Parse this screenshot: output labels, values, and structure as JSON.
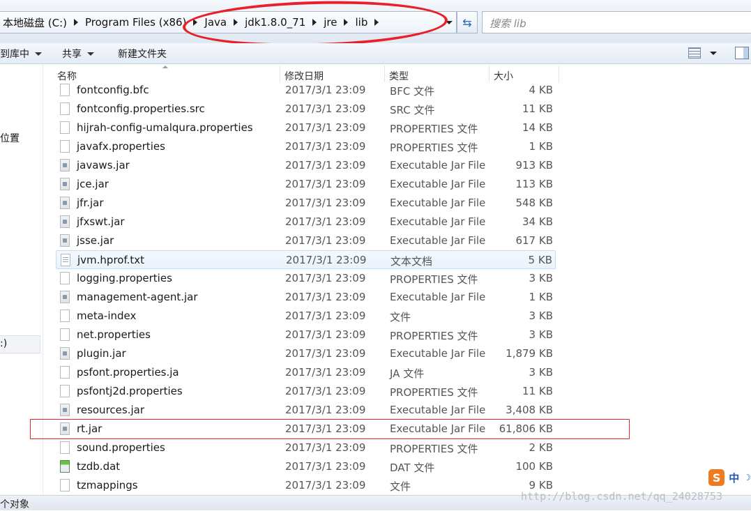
{
  "address_bar": {
    "segments": [
      "本地磁盘 (C:)",
      "Program Files (x86)",
      "Java",
      "jdk1.8.0_71",
      "jre",
      "lib"
    ],
    "search_placeholder": "搜索 lib"
  },
  "toolbar": {
    "organize_label": "到库中",
    "share_label": "共享",
    "new_folder_label": "新建文件夹"
  },
  "nav_pane": {
    "items": [
      "位置",
      ":)"
    ]
  },
  "columns": {
    "name": "名称",
    "date": "修改日期",
    "type": "类型",
    "size": "大小"
  },
  "files": [
    {
      "name": "fontconfig.bfc",
      "date": "2017/3/1 23:09",
      "type": "BFC 文件",
      "size": "4 KB",
      "icon": "file-icon"
    },
    {
      "name": "fontconfig.properties.src",
      "date": "2017/3/1 23:09",
      "type": "SRC 文件",
      "size": "11 KB",
      "icon": "file-icon"
    },
    {
      "name": "hijrah-config-umalqura.properties",
      "date": "2017/3/1 23:09",
      "type": "PROPERTIES 文件",
      "size": "14 KB",
      "icon": "file-icon"
    },
    {
      "name": "javafx.properties",
      "date": "2017/3/1 23:09",
      "type": "PROPERTIES 文件",
      "size": "1 KB",
      "icon": "file-icon"
    },
    {
      "name": "javaws.jar",
      "date": "2017/3/1 23:09",
      "type": "Executable Jar File",
      "size": "913 KB",
      "icon": "jar-file-icon"
    },
    {
      "name": "jce.jar",
      "date": "2017/3/1 23:09",
      "type": "Executable Jar File",
      "size": "113 KB",
      "icon": "jar-file-icon"
    },
    {
      "name": "jfr.jar",
      "date": "2017/3/1 23:09",
      "type": "Executable Jar File",
      "size": "548 KB",
      "icon": "jar-file-icon"
    },
    {
      "name": "jfxswt.jar",
      "date": "2017/3/1 23:09",
      "type": "Executable Jar File",
      "size": "34 KB",
      "icon": "jar-file-icon"
    },
    {
      "name": "jsse.jar",
      "date": "2017/3/1 23:09",
      "type": "Executable Jar File",
      "size": "617 KB",
      "icon": "jar-file-icon"
    },
    {
      "name": "jvm.hprof.txt",
      "date": "2017/3/1 23:09",
      "type": "文本文档",
      "size": "5 KB",
      "icon": "text-file-icon"
    },
    {
      "name": "logging.properties",
      "date": "2017/3/1 23:09",
      "type": "PROPERTIES 文件",
      "size": "3 KB",
      "icon": "file-icon"
    },
    {
      "name": "management-agent.jar",
      "date": "2017/3/1 23:09",
      "type": "Executable Jar File",
      "size": "1 KB",
      "icon": "jar-file-icon"
    },
    {
      "name": "meta-index",
      "date": "2017/3/1 23:09",
      "type": "文件",
      "size": "3 KB",
      "icon": "file-icon"
    },
    {
      "name": "net.properties",
      "date": "2017/3/1 23:09",
      "type": "PROPERTIES 文件",
      "size": "3 KB",
      "icon": "file-icon"
    },
    {
      "name": "plugin.jar",
      "date": "2017/3/1 23:09",
      "type": "Executable Jar File",
      "size": "1,879 KB",
      "icon": "jar-file-icon"
    },
    {
      "name": "psfont.properties.ja",
      "date": "2017/3/1 23:09",
      "type": "JA 文件",
      "size": "3 KB",
      "icon": "file-icon"
    },
    {
      "name": "psfontj2d.properties",
      "date": "2017/3/1 23:09",
      "type": "PROPERTIES 文件",
      "size": "11 KB",
      "icon": "file-icon"
    },
    {
      "name": "resources.jar",
      "date": "2017/3/1 23:09",
      "type": "Executable Jar File",
      "size": "3,408 KB",
      "icon": "jar-file-icon"
    },
    {
      "name": "rt.jar",
      "date": "2017/3/1 23:09",
      "type": "Executable Jar File",
      "size": "61,806 KB",
      "icon": "jar-file-icon"
    },
    {
      "name": "sound.properties",
      "date": "2017/3/1 23:09",
      "type": "PROPERTIES 文件",
      "size": "2 KB",
      "icon": "file-icon"
    },
    {
      "name": "tzdb.dat",
      "date": "2017/3/1 23:09",
      "type": "DAT 文件",
      "size": "100 KB",
      "icon": "dat-file-icon"
    },
    {
      "name": "tzmappings",
      "date": "2017/3/1 23:09",
      "type": "文件",
      "size": "9 KB",
      "icon": "file-icon"
    }
  ],
  "status_bar": {
    "text": "个对象"
  },
  "watermark": "http://blog.csdn.net/qq_24028753",
  "ime": {
    "logo": "S",
    "mode": "中",
    "moon": "☽"
  },
  "colors": {
    "annotation_red": "#e8202a",
    "hover_blue": "#c5dcf3"
  }
}
